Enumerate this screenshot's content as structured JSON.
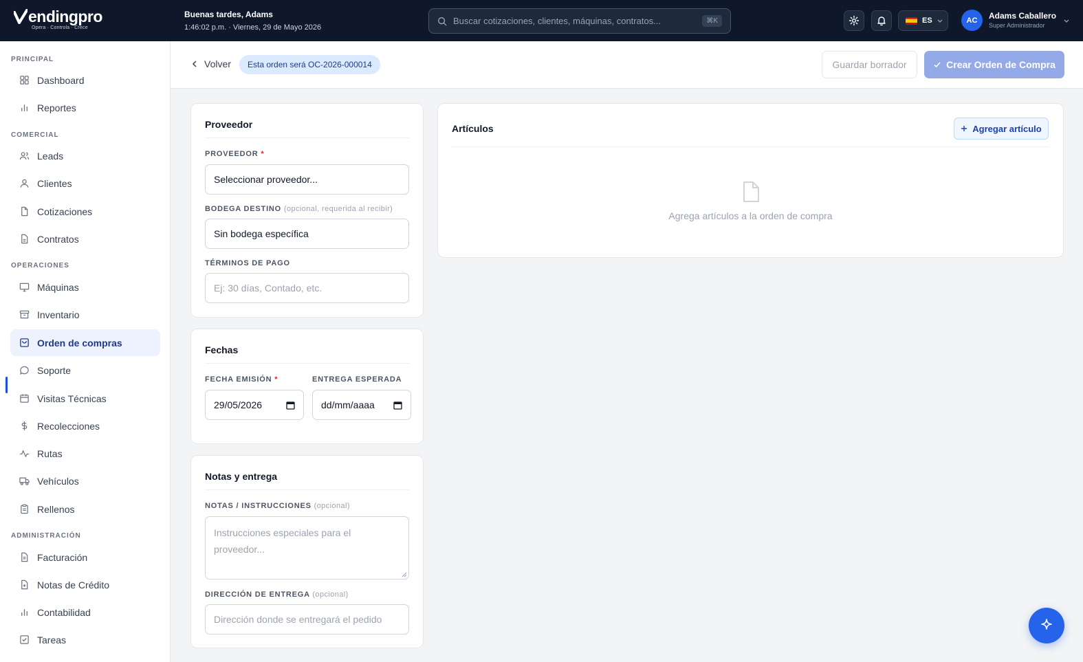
{
  "app": {
    "logo_text": "endingpro",
    "logo_tagline": "Opera · Controla · Crece",
    "greeting": "Buenas tardes, Adams",
    "datetime": "1:46:02 p.m. · Viernes, 29 de Mayo 2026"
  },
  "search": {
    "placeholder": "Buscar cotizaciones, clientes, máquinas, contratos...",
    "shortcut": "⌘K"
  },
  "topbar": {
    "language": "ES",
    "user_initials": "AC",
    "user_name": "Adams Caballero",
    "user_role": "Super Administrador"
  },
  "sidebar": {
    "sections": [
      {
        "label": "PRINCIPAL"
      },
      {
        "label": "COMERCIAL"
      },
      {
        "label": "OPERACIONES"
      },
      {
        "label": "ADMINISTRACIÓN"
      }
    ],
    "items": [
      {
        "label": "Dashboard",
        "icon": "grid-icon"
      },
      {
        "label": "Reportes",
        "icon": "bar-chart-icon"
      },
      {
        "label": "Leads",
        "icon": "users-icon"
      },
      {
        "label": "Clientes",
        "icon": "user-icon"
      },
      {
        "label": "Cotizaciones",
        "icon": "file-icon"
      },
      {
        "label": "Contratos",
        "icon": "file-text-icon"
      },
      {
        "label": "Máquinas",
        "icon": "monitor-icon"
      },
      {
        "label": "Inventario",
        "icon": "archive-icon"
      },
      {
        "label": "Orden de compras",
        "icon": "shopping-bag-icon",
        "active": true
      },
      {
        "label": "Soporte",
        "icon": "message-icon"
      },
      {
        "label": "Visitas Técnicas",
        "icon": "calendar-icon"
      },
      {
        "label": "Recolecciones",
        "icon": "dollar-icon"
      },
      {
        "label": "Rutas",
        "icon": "activity-icon"
      },
      {
        "label": "Vehículos",
        "icon": "truck-icon"
      },
      {
        "label": "Rellenos",
        "icon": "clipboard-icon"
      },
      {
        "label": "Facturación",
        "icon": "receipt-icon"
      },
      {
        "label": "Notas de Crédito",
        "icon": "file-plus-icon"
      },
      {
        "label": "Contabilidad",
        "icon": "bar-chart-icon"
      },
      {
        "label": "Tareas",
        "icon": "check-square-icon"
      }
    ]
  },
  "header": {
    "back_label": "Volver",
    "order_badge": "Esta orden será OC-2026-000014",
    "draft_label": "Guardar borrador",
    "create_label": "Crear Orden de Compra"
  },
  "proveedor_card": {
    "title": "Proveedor",
    "proveedor_label": "PROVEEDOR",
    "proveedor_value": "Seleccionar proveedor...",
    "bodega_label": "BODEGA DESTINO",
    "bodega_hint": "(opcional, requerida al recibir)",
    "bodega_value": "Sin bodega específica",
    "terminos_label": "TÉRMINOS DE PAGO",
    "terminos_placeholder": "Ej: 30 días, Contado, etc."
  },
  "fechas_card": {
    "title": "Fechas",
    "emision_label": "FECHA EMISIÓN",
    "emision_value": "29/05/2026",
    "entrega_label": "ENTREGA ESPERADA",
    "entrega_value": "dd/mm/aaaa"
  },
  "notas_card": {
    "title": "Notas y entrega",
    "notas_label": "NOTAS / INSTRUCCIONES",
    "notas_hint": "(opcional)",
    "notas_placeholder": "Instrucciones especiales para el proveedor...",
    "direccion_label": "DIRECCIÓN DE ENTREGA",
    "direccion_hint": "(opcional)",
    "direccion_placeholder": "Dirección donde se entregará el pedido"
  },
  "articulos_card": {
    "title": "Artículos",
    "add_label": "Agregar artículo",
    "empty_text": "Agrega artículos a la orden de compra"
  },
  "colors": {
    "topbar": "#0f172a",
    "accent": "#2563eb",
    "active_bg": "#eef2ff",
    "disabled_primary": "#93a9e8"
  }
}
